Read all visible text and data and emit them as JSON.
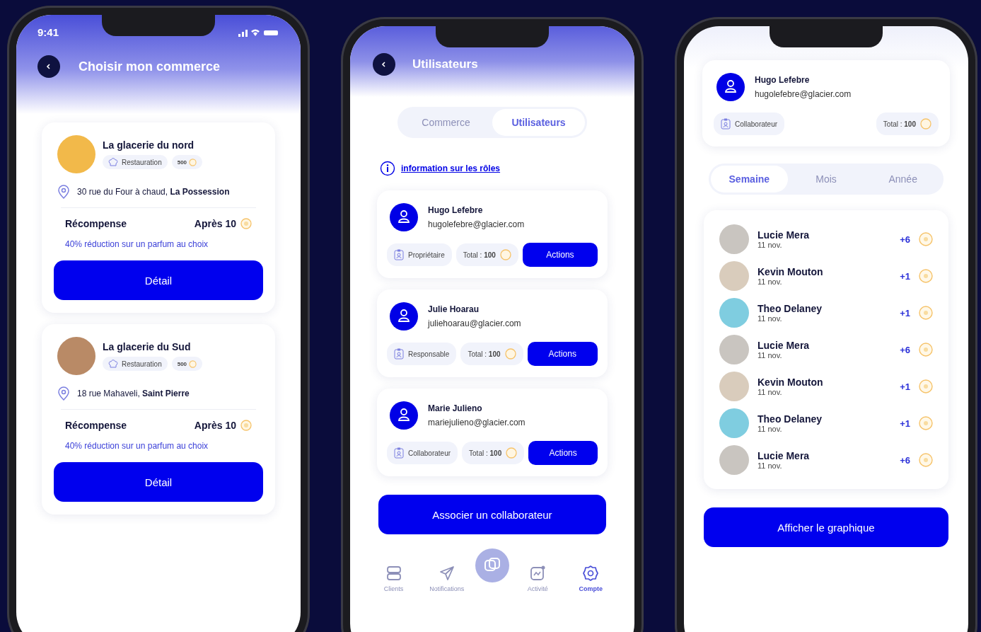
{
  "commerce_screen": {
    "status_bar": {
      "time": "9:41"
    },
    "title": "Choisir mon commerce",
    "shops": [
      {
        "name": "La glacerie du nord",
        "category": "Restauration",
        "points": "500",
        "address": "30 rue du Four à chaud, **La Possession**",
        "reward_label": "Récompense",
        "reward_threshold": "Après 10",
        "reward_text": "40% réduction sur un parfum au choix",
        "button": "Détail"
      },
      {
        "name": "La glacerie du Sud",
        "category": "Restauration",
        "points": "500",
        "address": "18 rue Mahaveli, **Saint Pierre**",
        "reward_label": "Récompense",
        "reward_threshold": "Après 10",
        "reward_text": "40% réduction sur un parfum au choix",
        "button": "Détail"
      }
    ]
  },
  "users_screen": {
    "title": "Utilisateurs",
    "tabs": [
      {
        "label": "Commerce",
        "selected": false
      },
      {
        "label": "Utilisateurs",
        "selected": true
      }
    ],
    "info_link": "information sur les rôles",
    "users": [
      {
        "name": "Hugo Lefebre",
        "email": "hugolefebre@glacier.com",
        "role": "Propriétaire",
        "total": "Total : **100**",
        "action": "Actions"
      },
      {
        "name": "Julie Hoarau",
        "email": "juliehoarau@glacier.com",
        "role": "Responsable",
        "total": "Total : **100**",
        "action": "Actions"
      },
      {
        "name": "Marie Julieno",
        "email": "mariejulieno@glacier.com",
        "role": "Collaborateur",
        "total": "Total : **100**",
        "action": "Actions"
      }
    ],
    "primary_button": "Associer un collaborateur",
    "nav": [
      {
        "kind": "list",
        "label": "Clients",
        "selected": false
      },
      {
        "kind": "send",
        "label": "Notifications",
        "selected": false
      },
      {
        "kind": "chart",
        "label": "Activité",
        "selected": false
      },
      {
        "kind": "gear",
        "label": "Compte",
        "selected": true
      }
    ]
  },
  "activity_screen": {
    "user": {
      "name": "Hugo Lefebre",
      "email": "hugolefebre@glacier.com",
      "role": "Collaborateur",
      "total": "Total : **100**"
    },
    "periods": [
      {
        "label": "Semaine",
        "selected": true
      },
      {
        "label": "Mois",
        "selected": false
      },
      {
        "label": "Année",
        "selected": false
      }
    ],
    "entries": [
      {
        "name": "Lucie Mera",
        "date": "11 nov.",
        "points": "+6"
      },
      {
        "name": "Kevin Mouton",
        "date": "11 nov.",
        "points": "+1"
      },
      {
        "name": "Theo Delaney",
        "date": "11 nov.",
        "points": "+1"
      },
      {
        "name": "Lucie Mera",
        "date": "11 nov.",
        "points": "+6"
      },
      {
        "name": "Kevin Mouton",
        "date": "11 nov.",
        "points": "+1"
      },
      {
        "name": "Theo Delaney",
        "date": "11 nov.",
        "points": "+1"
      },
      {
        "name": "Lucie Mera",
        "date": "11 nov.",
        "points": "+6"
      }
    ],
    "button": "Afficher le graphique"
  }
}
